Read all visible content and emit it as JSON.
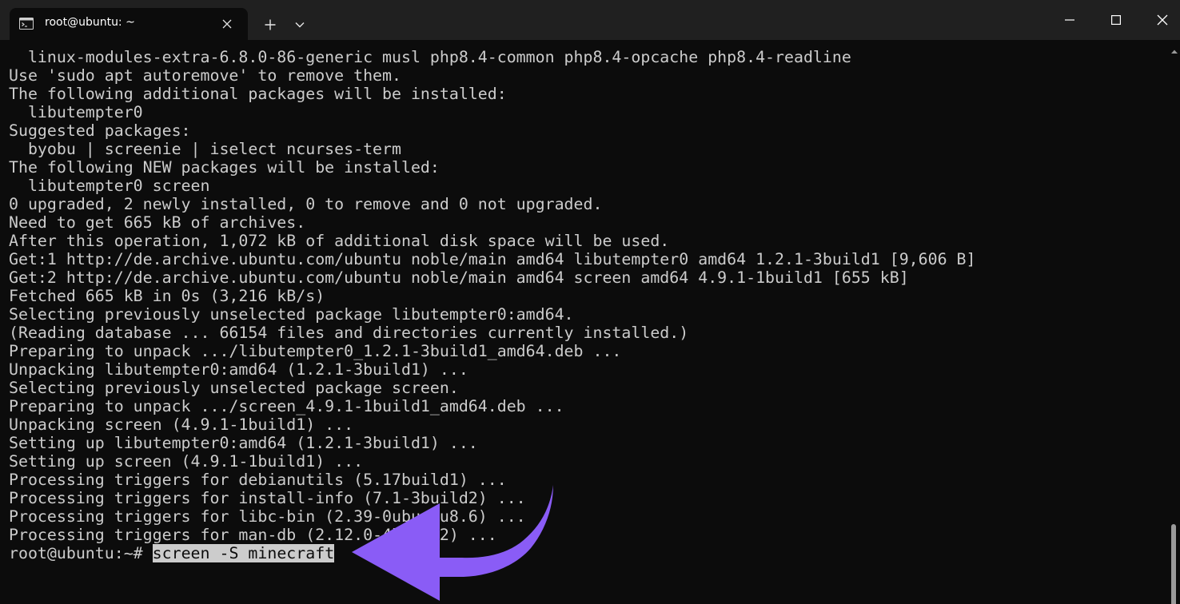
{
  "window": {
    "tab_title": "root@ubuntu: ~"
  },
  "icons": {
    "tab": "terminal-icon",
    "tab_close": "close-icon",
    "new_tab": "plus-icon",
    "dropdown": "chevron-down-icon",
    "minimize": "minimize-icon",
    "maximize": "maximize-icon",
    "close": "close-icon",
    "scroll_up": "arrow-up-icon",
    "annotation": "curved-arrow-annotation"
  },
  "colors": {
    "terminal_bg": "#0c0c0c",
    "titlebar_bg": "#202020",
    "text": "#cccccc",
    "annotation_arrow": "#8a5cf6"
  },
  "terminal": {
    "lines": [
      "  linux-modules-extra-6.8.0-86-generic musl php8.4-common php8.4-opcache php8.4-readline",
      "Use 'sudo apt autoremove' to remove them.",
      "The following additional packages will be installed:",
      "  libutempter0",
      "Suggested packages:",
      "  byobu | screenie | iselect ncurses-term",
      "The following NEW packages will be installed:",
      "  libutempter0 screen",
      "0 upgraded, 2 newly installed, 0 to remove and 0 not upgraded.",
      "Need to get 665 kB of archives.",
      "After this operation, 1,072 kB of additional disk space will be used.",
      "Get:1 http://de.archive.ubuntu.com/ubuntu noble/main amd64 libutempter0 amd64 1.2.1-3build1 [9,606 B]",
      "Get:2 http://de.archive.ubuntu.com/ubuntu noble/main amd64 screen amd64 4.9.1-1build1 [655 kB]",
      "Fetched 665 kB in 0s (3,216 kB/s)",
      "Selecting previously unselected package libutempter0:amd64.",
      "(Reading database ... 66154 files and directories currently installed.)",
      "Preparing to unpack .../libutempter0_1.2.1-3build1_amd64.deb ...",
      "Unpacking libutempter0:amd64 (1.2.1-3build1) ...",
      "Selecting previously unselected package screen.",
      "Preparing to unpack .../screen_4.9.1-1build1_amd64.deb ...",
      "Unpacking screen (4.9.1-1build1) ...",
      "Setting up libutempter0:amd64 (1.2.1-3build1) ...",
      "Setting up screen (4.9.1-1build1) ...",
      "Processing triggers for debianutils (5.17build1) ...",
      "Processing triggers for install-info (7.1-3build2) ...",
      "Processing triggers for libc-bin (2.39-0ubuntu8.6) ...",
      "Processing triggers for man-db (2.12.0-4build2) ..."
    ],
    "prompt": "root@ubuntu:~# ",
    "command": "screen -S minecraft"
  }
}
